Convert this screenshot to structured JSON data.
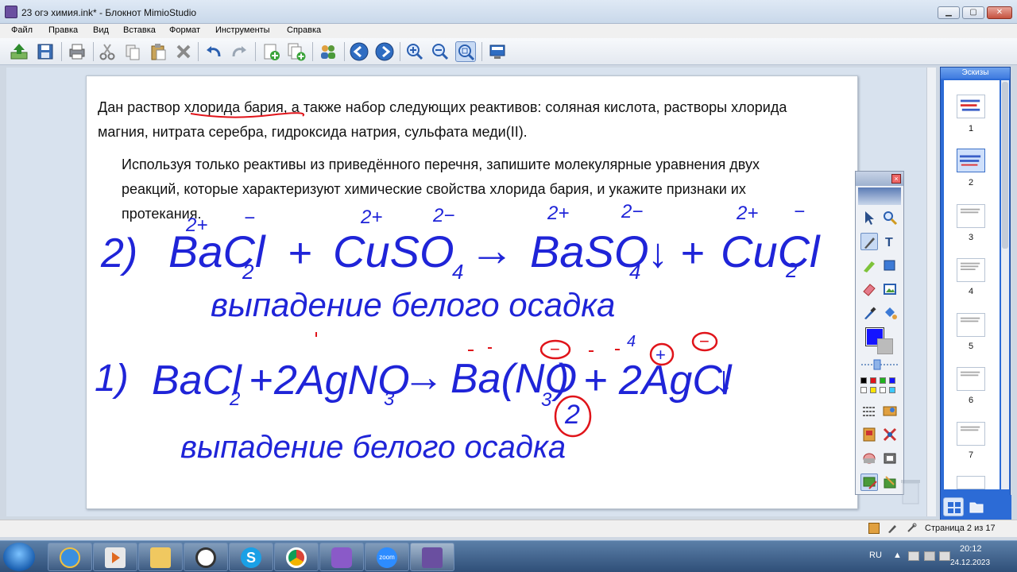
{
  "window": {
    "title": "23 огэ химия.ink* - Блокнот MimioStudio",
    "min": "▁",
    "max": "▢",
    "close": "✕"
  },
  "menu": [
    "Файл",
    "Правка",
    "Вид",
    "Вставка",
    "Формат",
    "Инструменты",
    "Справка"
  ],
  "toolbar": {
    "icons": [
      "import-icon",
      "save-icon",
      "print-icon",
      "cut-icon",
      "copy-icon",
      "paste-icon",
      "delete-icon",
      "undo-icon",
      "redo-icon",
      "new-page-icon",
      "duplicate-page-icon",
      "people-icon",
      "prev-page-icon",
      "next-page-icon",
      "zoom-in-icon",
      "zoom-out-icon",
      "zoom-fit-icon",
      "screen-icon"
    ]
  },
  "page": {
    "line1": "Дан раствор хлорида бария, а также набор следующих реактивов: соляная кислота, растворы хлорида",
    "line2": "магния, нитрата серебра, гидроксида натрия, сульфата меди(II).",
    "line3": "Используя только реактивы из приведённого перечня, запишите молекулярные уравнения двух",
    "line4": "реакций, которые характеризуют химические свойства хлорида бария, и укажите признаки их",
    "line5": "протекания.",
    "ink": {
      "eq2_num": "2)",
      "eq2_lhs1": "BaCl",
      "eq2_lhs1_sub": "2",
      "eq2_lhs1_sup": "2+",
      "eq2_plus": "+",
      "eq2_lhs2": "CuSO",
      "eq2_lhs2_sub": "4",
      "eq2_arrow": "→",
      "eq2_rhs1": "BaSO",
      "eq2_rhs1_sub": "4",
      "eq2_down": "↓",
      "eq2_rhs2": "CuCl",
      "eq2_rhs2_sub": "2",
      "eq2_note": "выпадение   белого   осадка",
      "eq1_num": "1)",
      "eq1_lhs": "BaCl",
      "eq1_lhs_sub": "2",
      "eq1_plus": "+",
      "eq1_lhs2": "2AgNO",
      "eq1_lhs2_sub": "3",
      "eq1_arrow": "→",
      "eq1_rhs1": "Ba(NO",
      "eq1_rhs1_sub": "3",
      "eq1_rhs1_close": ")",
      "eq1_rhs2": "+ 2AgCl",
      "eq1_down": "↓",
      "eq1_coef": "2",
      "eq1_note": "выпадение   белого   осадка",
      "sup_2plus": "2+",
      "sup_minus": "−",
      "sup_2minus": "2−",
      "sup_plus": "+",
      "sup_4": "4"
    }
  },
  "thumbnails": {
    "header": "Эскизы",
    "pages": [
      "1",
      "2",
      "3",
      "4",
      "5",
      "6",
      "7"
    ],
    "selected": 2
  },
  "status": {
    "page_text": "Страница 2 из 17"
  },
  "taskbar": {
    "lang": "RU",
    "time": "20:12",
    "date": "24.12.2023",
    "zoom_label": "zoom"
  },
  "colors": {
    "ink": "#1f24d8",
    "red": "#e0141a",
    "palette_blue": "#1414ff"
  }
}
